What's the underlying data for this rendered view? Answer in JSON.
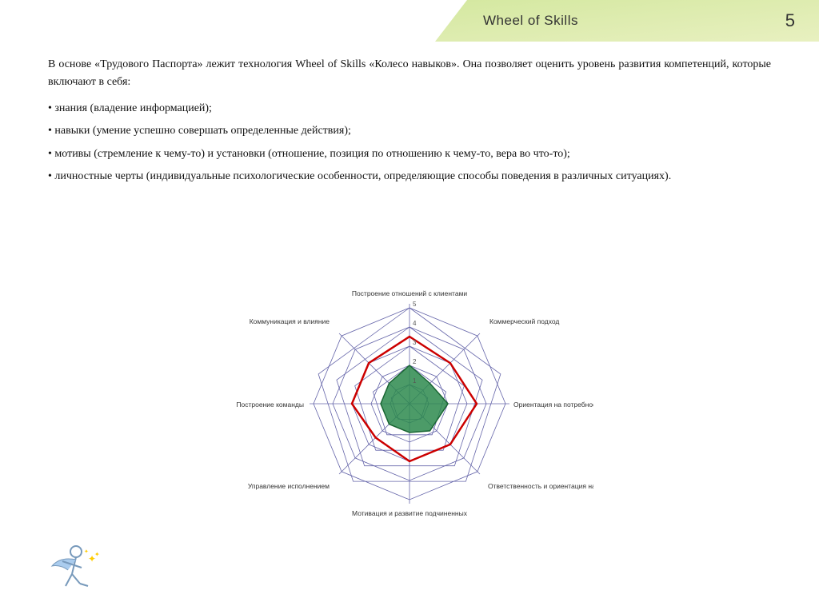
{
  "header": {
    "title": "Wheel of Skills",
    "page_number": "5"
  },
  "content": {
    "intro_text": "В  основе  «Трудового  Паспорта»   лежит  технология  Wheel  of  Skills  «Колесо  навыков».  Она позволяет оценить уровень развития компетенций, которые включают в себя:",
    "bullets": [
      "• знания (владение информацией);",
      "• навыки (умение успешно совершать определенные действия);",
      "• мотивы (стремление к чему-то) и установки (отношение, позиция по отношению к чему-то, вера во что-то);",
      "• личностные  черты  (индивидуальные  психологические  особенности,  определяющие способы поведения в различных ситуациях)."
    ]
  },
  "chart": {
    "labels": [
      "Построение отношений с клиентами",
      "Коммерческий подход",
      "Ориентация на потребности клиента",
      "Ответственность и ориентация на результат",
      "Мотивация и развитие подчиненных",
      "Управление исполнением",
      "Построение команды",
      "Коммуникация и влияние"
    ],
    "levels": [
      1,
      2,
      3,
      4,
      5
    ],
    "accent_color": "#cc0000",
    "fill_color": "#2d8a4e",
    "grid_color": "#6666aa"
  }
}
